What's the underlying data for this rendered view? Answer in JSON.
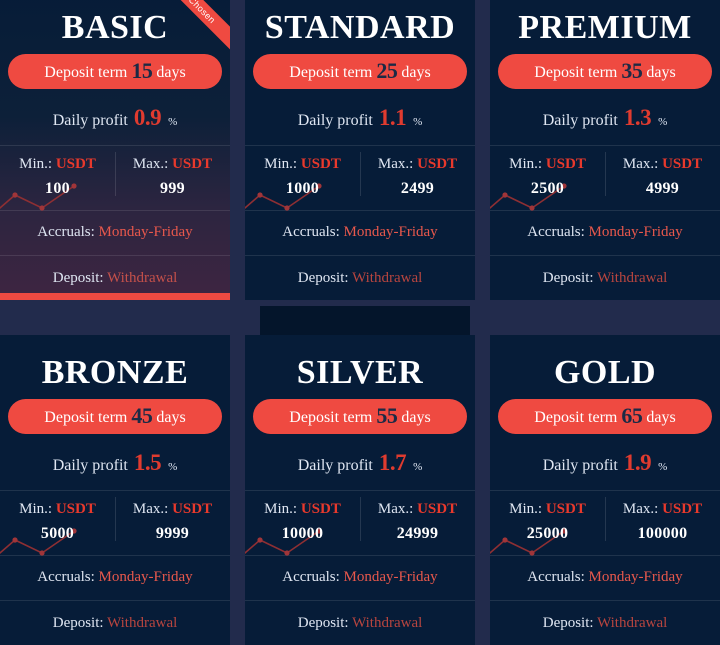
{
  "theme": {
    "page_background": "#222b4c",
    "card_background": "#061c38",
    "accent_red": "#ef4a41",
    "text_light": "#dfe6f2",
    "text_white": "#ffffff",
    "value_red": "#e8392c"
  },
  "labels": {
    "deposit_term_prefix": "Deposit term",
    "deposit_term_suffix": "days",
    "daily_profit_prefix": "Daily profit",
    "percent_sign": "%",
    "min_label": "Min.:",
    "max_label": "Max.:",
    "currency": "USDT",
    "accruals_label": "Accruals:",
    "deposit_label": "Deposit:",
    "chosen_ribbon": "Chosen"
  },
  "plans": [
    {
      "name": "BASIC",
      "term_days": "15",
      "daily_profit": "0.9",
      "min_amount": "100",
      "max_amount": "999",
      "accruals": "Monday-Friday",
      "deposit": "Withdrawal",
      "chosen": true
    },
    {
      "name": "STANDARD",
      "term_days": "25",
      "daily_profit": "1.1",
      "min_amount": "1000",
      "max_amount": "2499",
      "accruals": "Monday-Friday",
      "deposit": "Withdrawal",
      "chosen": false
    },
    {
      "name": "PREMIUM",
      "term_days": "35",
      "daily_profit": "1.3",
      "min_amount": "2500",
      "max_amount": "4999",
      "accruals": "Monday-Friday",
      "deposit": "Withdrawal",
      "chosen": false
    },
    {
      "name": "BRONZE",
      "term_days": "45",
      "daily_profit": "1.5",
      "min_amount": "5000",
      "max_amount": "9999",
      "accruals": "Monday-Friday",
      "deposit": "Withdrawal",
      "chosen": false
    },
    {
      "name": "SILVER",
      "term_days": "55",
      "daily_profit": "1.7",
      "min_amount": "10000",
      "max_amount": "24999",
      "accruals": "Monday-Friday",
      "deposit": "Withdrawal",
      "chosen": false
    },
    {
      "name": "GOLD",
      "term_days": "65",
      "daily_profit": "1.9",
      "min_amount": "25000",
      "max_amount": "100000",
      "accruals": "Monday-Friday",
      "deposit": "Withdrawal",
      "chosen": false
    }
  ]
}
